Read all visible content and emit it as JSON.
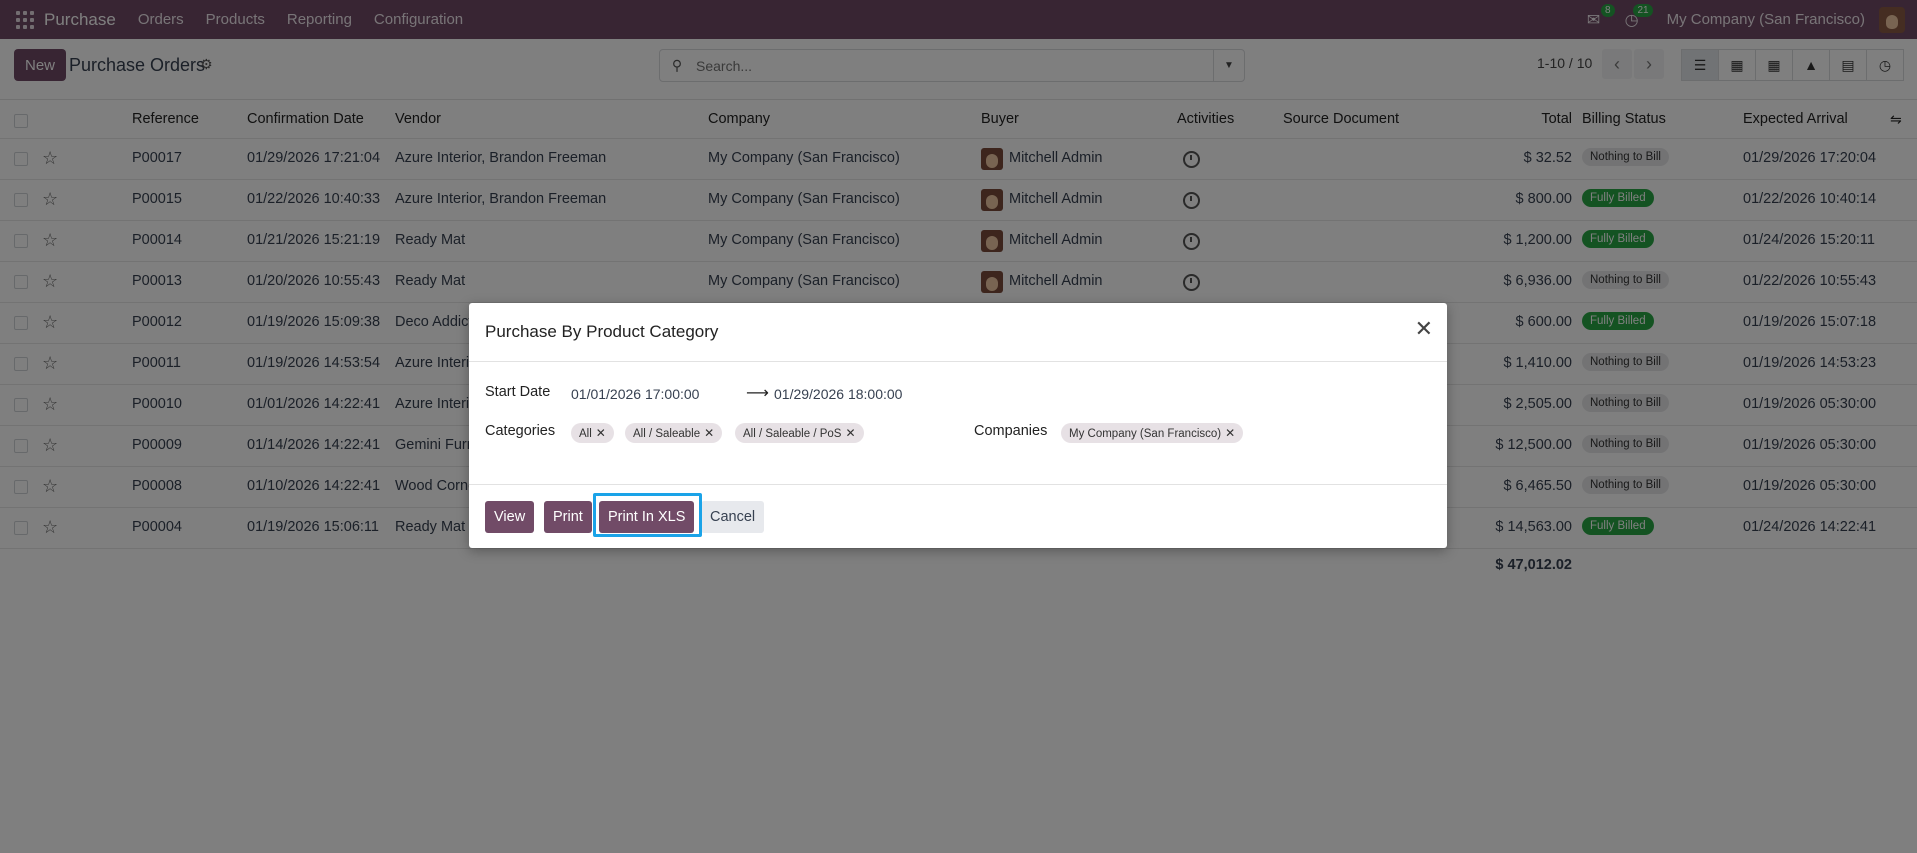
{
  "topbar": {
    "app": "Purchase",
    "menus": [
      "Orders",
      "Products",
      "Reporting",
      "Configuration"
    ],
    "messages_count": "8",
    "activities_count": "21",
    "company": "My Company (San Francisco)"
  },
  "control_panel": {
    "new_label": "New",
    "title": "Purchase Orders",
    "search_placeholder": "Search...",
    "pager": "1-10 / 10"
  },
  "table": {
    "headers": {
      "reference": "Reference",
      "confirmation_date": "Confirmation Date",
      "vendor": "Vendor",
      "company": "Company",
      "buyer": "Buyer",
      "activities": "Activities",
      "source_document": "Source Document",
      "total": "Total",
      "billing_status": "Billing Status",
      "expected_arrival": "Expected Arrival"
    },
    "rows": [
      {
        "ref": "P00017",
        "date": "01/29/2026 17:21:04",
        "vendor": "Azure Interior, Brandon Freeman",
        "company": "My Company (San Francisco)",
        "buyer": "Mitchell Admin",
        "total": "$ 32.52",
        "status": "Nothing to Bill",
        "arrival": "01/29/2026 17:20:04"
      },
      {
        "ref": "P00015",
        "date": "01/22/2026 10:40:33",
        "vendor": "Azure Interior, Brandon Freeman",
        "company": "My Company (San Francisco)",
        "buyer": "Mitchell Admin",
        "total": "$ 800.00",
        "status": "Fully Billed",
        "arrival": "01/22/2026 10:40:14"
      },
      {
        "ref": "P00014",
        "date": "01/21/2026 15:21:19",
        "vendor": "Ready Mat",
        "company": "My Company (San Francisco)",
        "buyer": "Mitchell Admin",
        "total": "$ 1,200.00",
        "status": "Fully Billed",
        "arrival": "01/24/2026 15:20:11"
      },
      {
        "ref": "P00013",
        "date": "01/20/2026 10:55:43",
        "vendor": "Ready Mat",
        "company": "My Company (San Francisco)",
        "buyer": "Mitchell Admin",
        "total": "$ 6,936.00",
        "status": "Nothing to Bill",
        "arrival": "01/22/2026 10:55:43"
      },
      {
        "ref": "P00012",
        "date": "01/19/2026 15:09:38",
        "vendor": "Deco Addict",
        "company": "",
        "buyer": "",
        "total": "$ 600.00",
        "status": "Fully Billed",
        "arrival": "01/19/2026 15:07:18"
      },
      {
        "ref": "P00011",
        "date": "01/19/2026 14:53:54",
        "vendor": "Azure Interi",
        "company": "",
        "buyer": "",
        "total": "$ 1,410.00",
        "status": "Nothing to Bill",
        "arrival": "01/19/2026 14:53:23"
      },
      {
        "ref": "P00010",
        "date": "01/01/2026 14:22:41",
        "vendor": "Azure Interi",
        "company": "",
        "buyer": "",
        "total": "$ 2,505.00",
        "status": "Nothing to Bill",
        "arrival": "01/19/2026 05:30:00"
      },
      {
        "ref": "P00009",
        "date": "01/14/2026 14:22:41",
        "vendor": "Gemini Furn",
        "company": "",
        "buyer": "",
        "total": "$ 12,500.00",
        "status": "Nothing to Bill",
        "arrival": "01/19/2026 05:30:00"
      },
      {
        "ref": "P00008",
        "date": "01/10/2026 14:22:41",
        "vendor": "Wood Corne",
        "company": "",
        "buyer": "",
        "total": "$ 6,465.50",
        "status": "Nothing to Bill",
        "arrival": "01/19/2026 05:30:00"
      },
      {
        "ref": "P00004",
        "date": "01/19/2026 15:06:11",
        "vendor": "Ready Mat",
        "company": "",
        "buyer": "",
        "total": "$ 14,563.00",
        "status": "Fully Billed",
        "arrival": "01/24/2026 14:22:41"
      }
    ],
    "sum_total": "$ 47,012.02"
  },
  "dialog": {
    "title": "Purchase By Product Category",
    "start_date_label": "Start Date",
    "start_date": "01/01/2026 17:00:00",
    "end_date": "01/29/2026 18:00:00",
    "categories_label": "Categories",
    "categories": [
      "All",
      "All / Saleable",
      "All / Saleable / PoS"
    ],
    "companies_label": "Companies",
    "companies": [
      "My Company (San Francisco)"
    ],
    "buttons": {
      "view": "View",
      "print": "Print",
      "print_xls": "Print In XLS",
      "cancel": "Cancel"
    }
  }
}
